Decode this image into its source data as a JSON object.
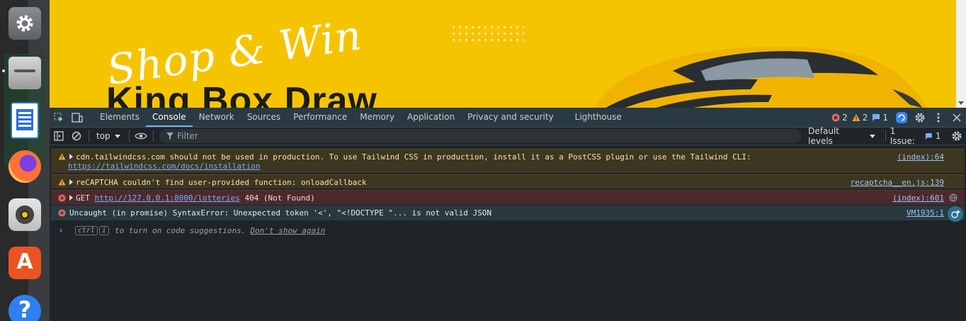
{
  "banner": {
    "script_text": "Shop & Win",
    "headline": "King Box Draw",
    "background_color": "#f5c400"
  },
  "dock": {
    "apps": [
      "settings-icon",
      "files-icon",
      "writer-icon",
      "firefox-icon",
      "rhythmbox-icon",
      "app-center-icon",
      "help-icon"
    ],
    "help_glyph": "?",
    "appcenter_glyph": "A"
  },
  "devtools": {
    "tabs": [
      "Elements",
      "Console",
      "Network",
      "Sources",
      "Performance",
      "Memory",
      "Application",
      "Privacy and security",
      "Lighthouse"
    ],
    "active_tab": "Console",
    "counters": {
      "errors": "2",
      "warnings": "2",
      "messages": "1"
    },
    "toolbar": {
      "context": "top",
      "filter_placeholder": "Filter",
      "levels": "Default levels",
      "issues_label": "1 Issue:",
      "issues_count": "1"
    },
    "messages": [
      {
        "level": "warning",
        "text": "cdn.tailwindcss.com should not be used in production. To use Tailwind CSS in production, install it as a PostCSS plugin or use the Tailwind CLI:",
        "link": "https://tailwindcss.com/docs/installation",
        "source": "(index):64"
      },
      {
        "level": "warning",
        "text": "reCAPTCHA couldn't find user-provided function: onloadCallback",
        "source": "recaptcha__en.js:139"
      },
      {
        "level": "error",
        "method": "GET",
        "link": "http://127.0.0.1:8000/lotteries",
        "status": "404 (Not Found)",
        "source": "(index):601"
      },
      {
        "level": "error",
        "text": "Uncaught (in promise) SyntaxError: Unexpected token '<', \"<!DOCTYPE \"... is not valid JSON",
        "source": "VM1935:1"
      }
    ],
    "prompt": {
      "key1": "ctrl",
      "key2": "i",
      "hint": "to turn on code suggestions.",
      "dismiss": "Don't show again"
    }
  }
}
